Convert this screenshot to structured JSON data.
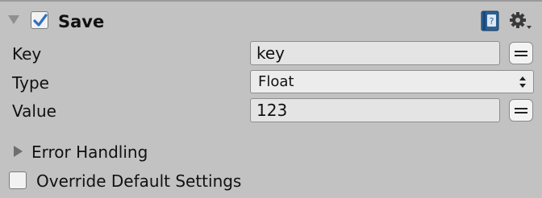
{
  "component": {
    "title": "Save",
    "enabled": true,
    "icons": {
      "help": "help-book-icon",
      "settings": "gear-icon",
      "collapse": "triangle-down-icon"
    }
  },
  "fields": {
    "key": {
      "label": "Key",
      "value": "key"
    },
    "type": {
      "label": "Type",
      "selected": "Float"
    },
    "value": {
      "label": "Value",
      "value": "123"
    }
  },
  "error_handling": {
    "label": "Error Handling",
    "expanded": false
  },
  "override": {
    "label": "Override Default Settings",
    "checked": false
  },
  "colors": {
    "panel": "#c2c2c2",
    "field": "#e4e4e4",
    "check": "#2f6fc2"
  }
}
